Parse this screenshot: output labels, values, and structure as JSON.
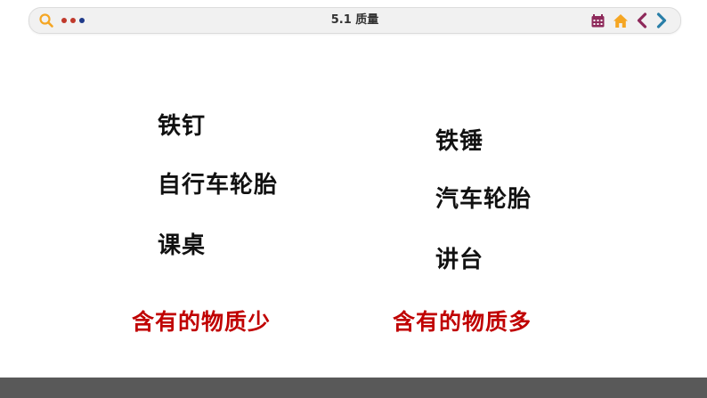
{
  "header": {
    "title": "5.1 质量",
    "dots": [
      "#c0392b",
      "#c0392b",
      "#1f3a8a"
    ],
    "accent": "#f5a623"
  },
  "left_list": [
    "铁钉",
    "自行车轮胎",
    "课桌"
  ],
  "right_list": [
    "铁锤",
    "汽车轮胎",
    "讲台"
  ],
  "summary": {
    "left": "含有的物质少",
    "right": "含有的物质多",
    "color": "#c00000"
  },
  "icons": {
    "search": "search-icon",
    "calendar": "calendar-icon",
    "home": "home-icon",
    "prev": "chevron-left-icon",
    "next": "chevron-right-icon"
  }
}
